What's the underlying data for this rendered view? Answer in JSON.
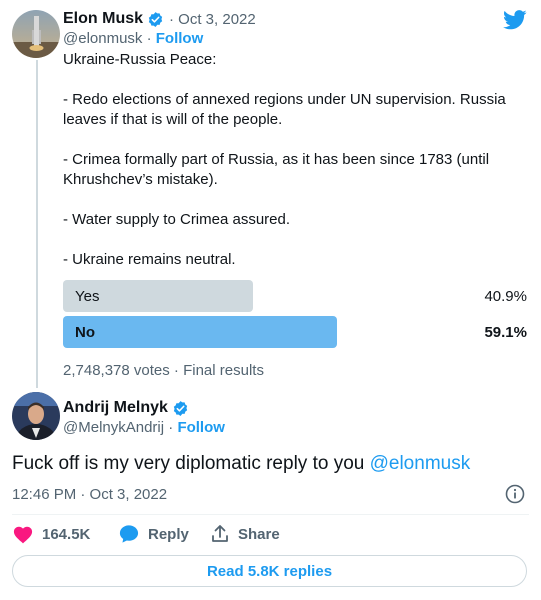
{
  "original_tweet": {
    "author_name": "Elon Musk",
    "date": "· Oct 3, 2022",
    "handle": "@elonmusk ·",
    "follow_label": "Follow",
    "text_lines": [
      "Ukraine-Russia Peace:",
      "",
      "- Redo elections of annexed regions under UN supervision. Russia leaves if that is will of the people.",
      "",
      "- Crimea formally part of Russia, as it has been since 1783 (until Khrushchev’s mistake).",
      "",
      "- Water supply to Crimea assured.",
      "",
      "- Ukraine remains neutral."
    ],
    "poll": {
      "options": [
        {
          "label": "Yes",
          "percent_text": "40.9%",
          "fraction": 0.409,
          "winner": false
        },
        {
          "label": "No",
          "percent_text": "59.1%",
          "fraction": 0.591,
          "winner": true
        }
      ],
      "votes_text": "2,748,378 votes · Final results"
    }
  },
  "reply_tweet": {
    "author_name": "Andrij Melnyk",
    "handle": "@MelnykAndrij ·",
    "follow_label": "Follow",
    "text": "Fuck off is my very diplomatic reply to you ",
    "mention": "@elonmusk",
    "timestamp": "12:46 PM · Oct 3, 2022"
  },
  "actions": {
    "likes": "164.5K",
    "reply_label": "Reply",
    "share_label": "Share",
    "read_replies_label": "Read 5.8K replies"
  },
  "icons": {
    "verified": "verified-badge-icon",
    "brand": "twitter-bird-icon",
    "like": "heart-icon",
    "reply": "reply-bubble-icon",
    "share": "share-icon",
    "info": "info-icon"
  },
  "colors": {
    "accent": "#1d9bf0",
    "poll_winner": "#6ab8f0",
    "poll_other": "#cfd9de",
    "like": "#f91880",
    "text": "#0f1419",
    "muted": "#536471"
  }
}
